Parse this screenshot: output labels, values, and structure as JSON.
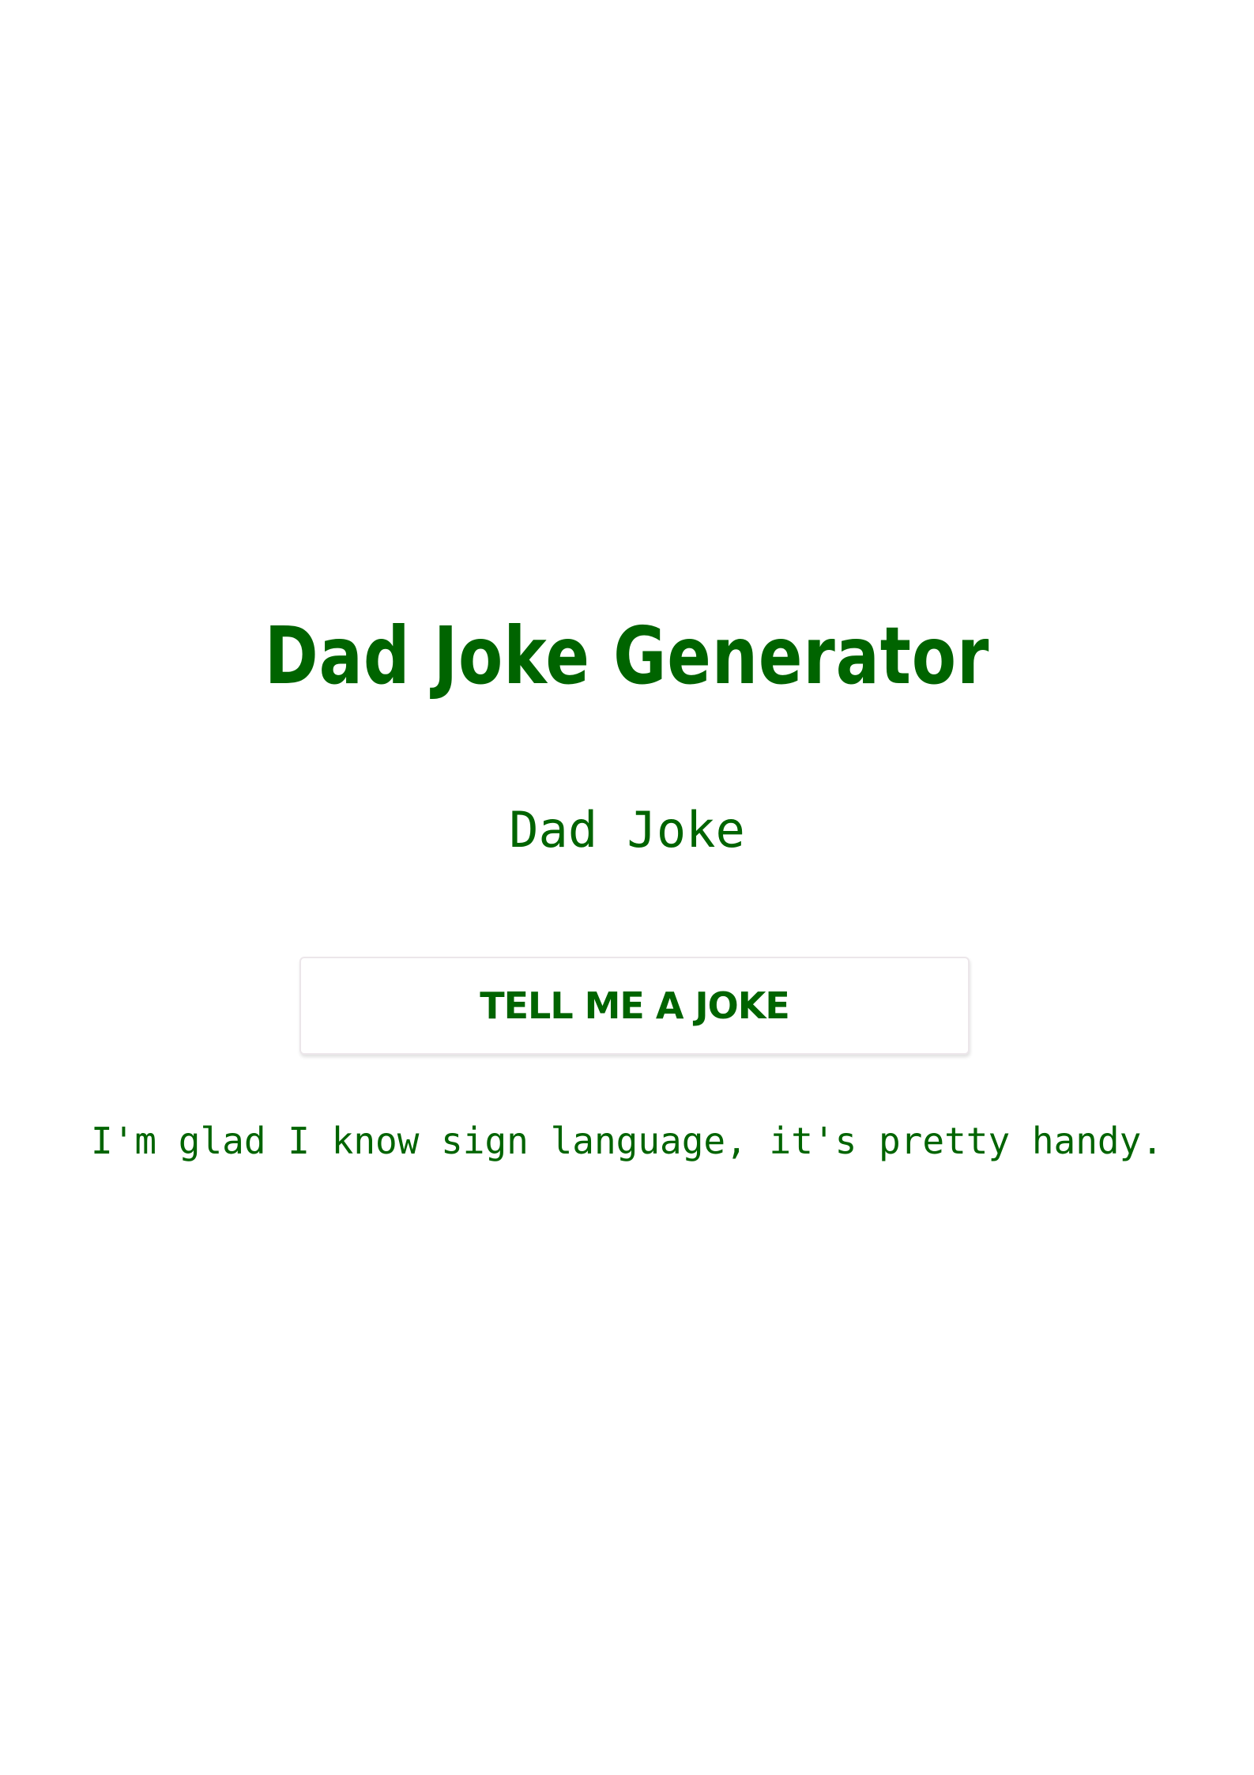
{
  "header": {
    "title": "Dad Joke Generator",
    "subtitle": "Dad Joke"
  },
  "actions": {
    "joke_button_label": "TELL ME A JOKE"
  },
  "joke": {
    "text": "I'm glad I know sign language, it's pretty handy."
  },
  "colors": {
    "accent": "#006400",
    "background": "#ffffff",
    "button_border": "#ece6ea"
  }
}
